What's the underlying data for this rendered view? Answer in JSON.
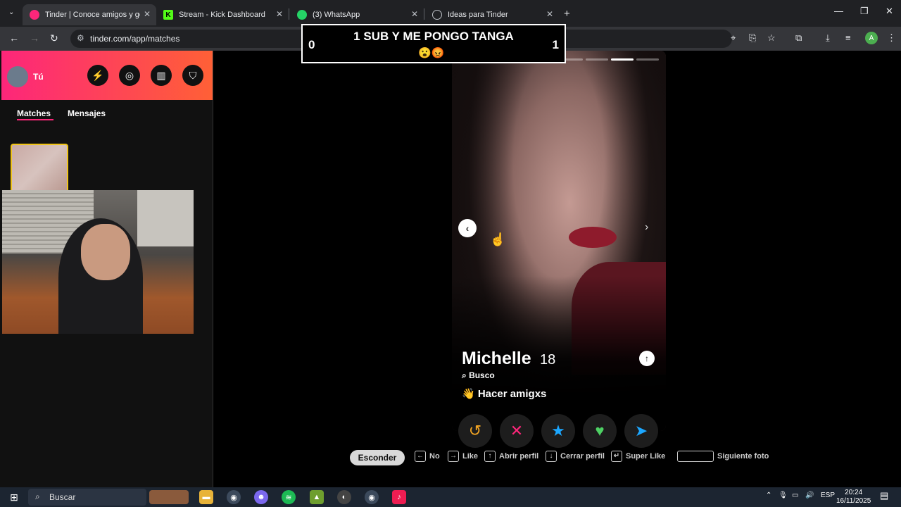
{
  "browser": {
    "tabs": [
      {
        "label": "Tinder | Conoce amigos y gente",
        "favicon": "tinder-icon",
        "color": "#fd267a"
      },
      {
        "label": "Stream - Kick Dashboard",
        "favicon": "kick-icon",
        "color": "#53fc18"
      },
      {
        "label": "(3) WhatsApp",
        "favicon": "whatsapp-icon",
        "color": "#25d366"
      },
      {
        "label": "Ideas para Tinder",
        "favicon": "chatgpt-icon",
        "color": "#bdc1c6"
      }
    ],
    "url": "tinder.com/app/matches",
    "profile_initial": "A"
  },
  "overlay": {
    "title": "1 SUB Y ME PONGO TANGA",
    "score_left": "0",
    "score_right": "1",
    "emojis": "😮😡"
  },
  "sidebar": {
    "user_label": "Tú",
    "tabs": {
      "matches": "Matches",
      "messages": "Mensajes"
    }
  },
  "profile": {
    "name": "Michelle",
    "age": "18",
    "looking_label": "Busco",
    "looking_value": "👋 Hacer amigxs",
    "photo_count": 8,
    "current_photo": 7
  },
  "actions": {
    "rewind": "↺",
    "nope": "✕",
    "superlike": "★",
    "like": "♥",
    "boost": "➤"
  },
  "hints": {
    "hide": "Esconder",
    "no": "No",
    "like": "Like",
    "open": "Abrir perfil",
    "close": "Cerrar perfil",
    "superlike": "Super Like",
    "next_photo": "Siguiente foto"
  },
  "taskbar": {
    "search": "Buscar",
    "lang": "ESP",
    "time": "20:24",
    "date": "16/11/2025"
  },
  "colors": {
    "accent": "#fd267a",
    "accent2": "#ff6036"
  }
}
